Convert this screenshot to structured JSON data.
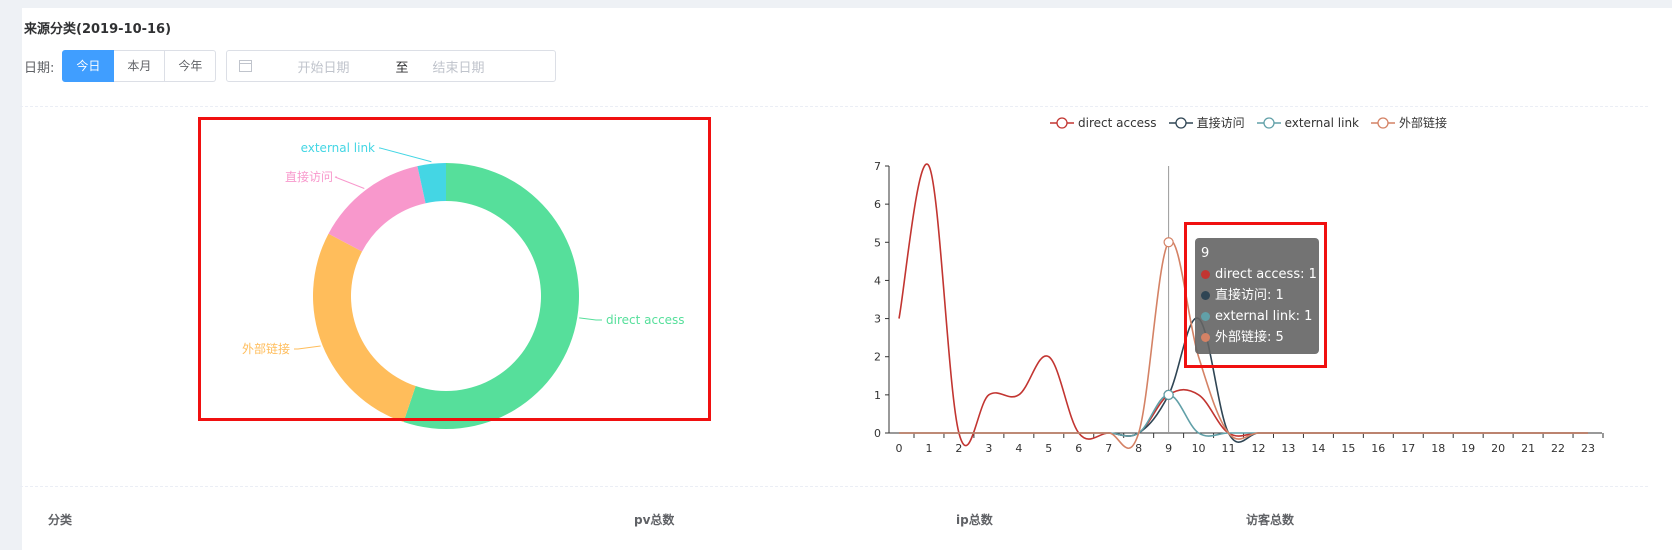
{
  "panel": {
    "title": "来源分类(2019-10-16)",
    "date_label": "日期:",
    "buttons": [
      "今日",
      "本月",
      "今年"
    ],
    "active_button": 0,
    "date_start_placeholder": "开始日期",
    "date_separator": "至",
    "date_end_placeholder": "结束日期"
  },
  "table": {
    "headers": [
      "分类",
      "pv总数",
      "ip总数",
      "访客总数"
    ]
  },
  "tooltip": {
    "title": "9",
    "rows": [
      {
        "label": "direct access: 1",
        "color": "#c23531"
      },
      {
        "label": "直接访问: 1",
        "color": "#2f4554"
      },
      {
        "label": "external link: 1",
        "color": "#61a0a8"
      },
      {
        "label": "外部链接: 5",
        "color": "#d48265"
      }
    ]
  },
  "chart_data": [
    {
      "type": "pie",
      "donut": true,
      "title": "",
      "slices": [
        {
          "name": "direct access",
          "value": 8,
          "color": "#56df9b"
        },
        {
          "name": "外部链接",
          "value": 4,
          "color": "#ffbd5b"
        },
        {
          "name": "直接访问",
          "value": 2,
          "color": "#f898cc"
        },
        {
          "name": "external link",
          "value": 0.5,
          "color": "#44d6e4"
        }
      ]
    },
    {
      "type": "line",
      "smooth": true,
      "title": "",
      "x": [
        0,
        1,
        2,
        3,
        4,
        5,
        6,
        7,
        8,
        9,
        10,
        11,
        12,
        13,
        14,
        15,
        16,
        17,
        18,
        19,
        20,
        21,
        22,
        23
      ],
      "xlim": [
        0,
        23
      ],
      "ylim": [
        0,
        7
      ],
      "yticks": [
        0,
        1,
        2,
        3,
        4,
        5,
        6,
        7
      ],
      "legend_position": "top",
      "hover_x": 9,
      "series": [
        {
          "name": "direct access",
          "color": "#c23531",
          "values": [
            3,
            7,
            0,
            1,
            1,
            2,
            0,
            0,
            0,
            1,
            1,
            0,
            0,
            0,
            0,
            0,
            0,
            0,
            0,
            0,
            0,
            0,
            0,
            0
          ]
        },
        {
          "name": "直接访问",
          "color": "#2f4554",
          "values": [
            0,
            0,
            0,
            0,
            0,
            0,
            0,
            0,
            0,
            1,
            3,
            0,
            0,
            0,
            0,
            0,
            0,
            0,
            0,
            0,
            0,
            0,
            0,
            0
          ]
        },
        {
          "name": "external link",
          "color": "#61a0a8",
          "values": [
            0,
            0,
            0,
            0,
            0,
            0,
            0,
            0,
            0,
            1,
            0,
            0,
            0,
            0,
            0,
            0,
            0,
            0,
            0,
            0,
            0,
            0,
            0,
            0
          ]
        },
        {
          "name": "外部链接",
          "color": "#d48265",
          "values": [
            0,
            0,
            0,
            0,
            0,
            0,
            0,
            0,
            0,
            5,
            2,
            0,
            0,
            0,
            0,
            0,
            0,
            0,
            0,
            0,
            0,
            0,
            0,
            0
          ]
        }
      ]
    }
  ]
}
